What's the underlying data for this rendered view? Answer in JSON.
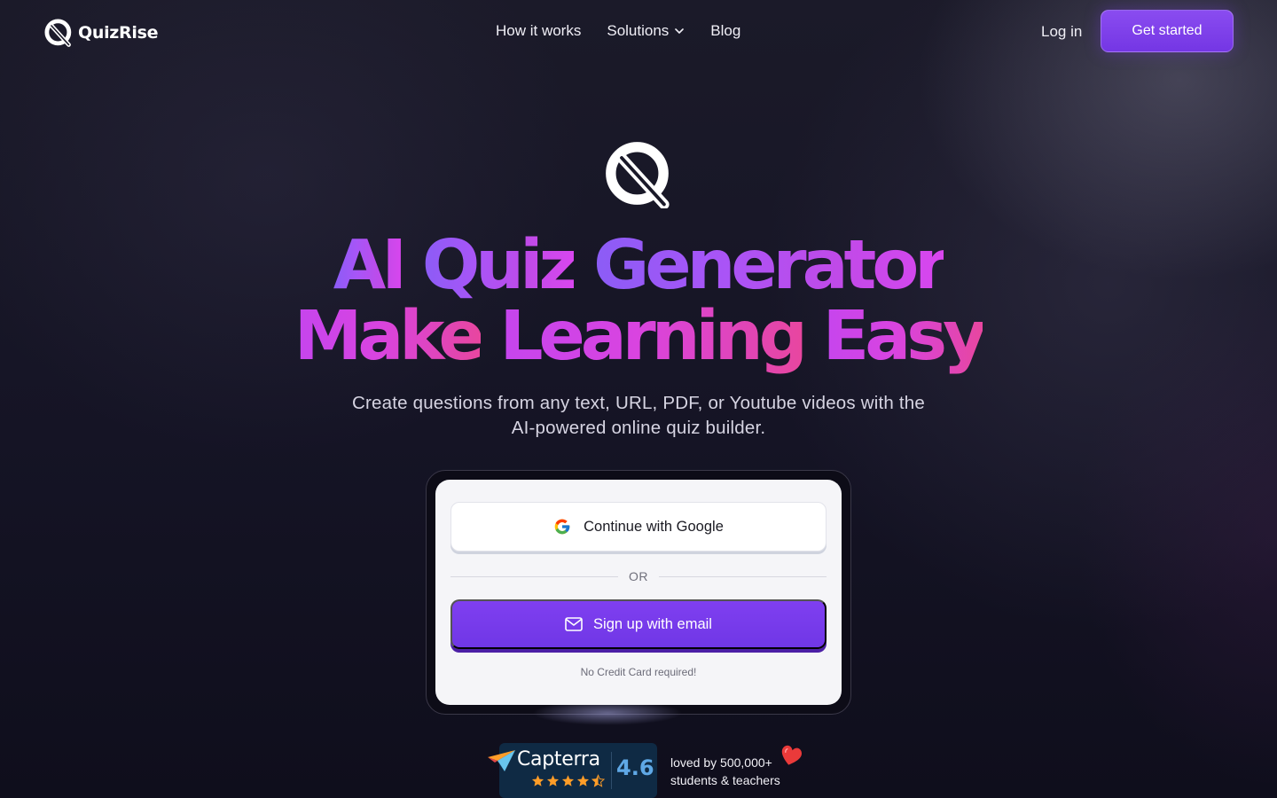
{
  "colors": {
    "accent": "#7c3aed",
    "headline_gradient_start": "#8b5cf6",
    "headline_gradient_end": "#e8469f",
    "background": "#151425",
    "card_background": "#f5f5f8",
    "capterra_background": "#0f2a44",
    "capterra_score": "#5fa8e6"
  },
  "header": {
    "brand": "QuizRise",
    "nav": [
      {
        "label": "How it works"
      },
      {
        "label": "Solutions",
        "icon": "chevron-down-icon"
      },
      {
        "label": "Blog"
      }
    ],
    "login_label": "Log in",
    "cta_label": "Get started"
  },
  "hero": {
    "logo_icon": "quizrise-logo-icon",
    "headline_line1_words": [
      "AI",
      "Quiz",
      "Generator"
    ],
    "headline_line2_words": [
      "Make",
      "Learning",
      "Easy"
    ],
    "subtitle_line1": "Create questions from any text, URL, PDF, or Youtube videos with the",
    "subtitle_line2": "AI-powered online quiz builder."
  },
  "auth_card": {
    "google_label": "Continue with Google",
    "google_icon": "google-icon",
    "or_label": "OR",
    "email_label": "Sign up with email",
    "email_icon": "mail-icon",
    "footnote": "No Credit Card required!"
  },
  "social_proof": {
    "capterra_name": "Capterra",
    "capterra_rating": "4.6",
    "capterra_stars": 4.5,
    "loved_line1": "loved by 500,000+",
    "loved_line2": "students & teachers",
    "heart_icon": "heart-icon"
  }
}
